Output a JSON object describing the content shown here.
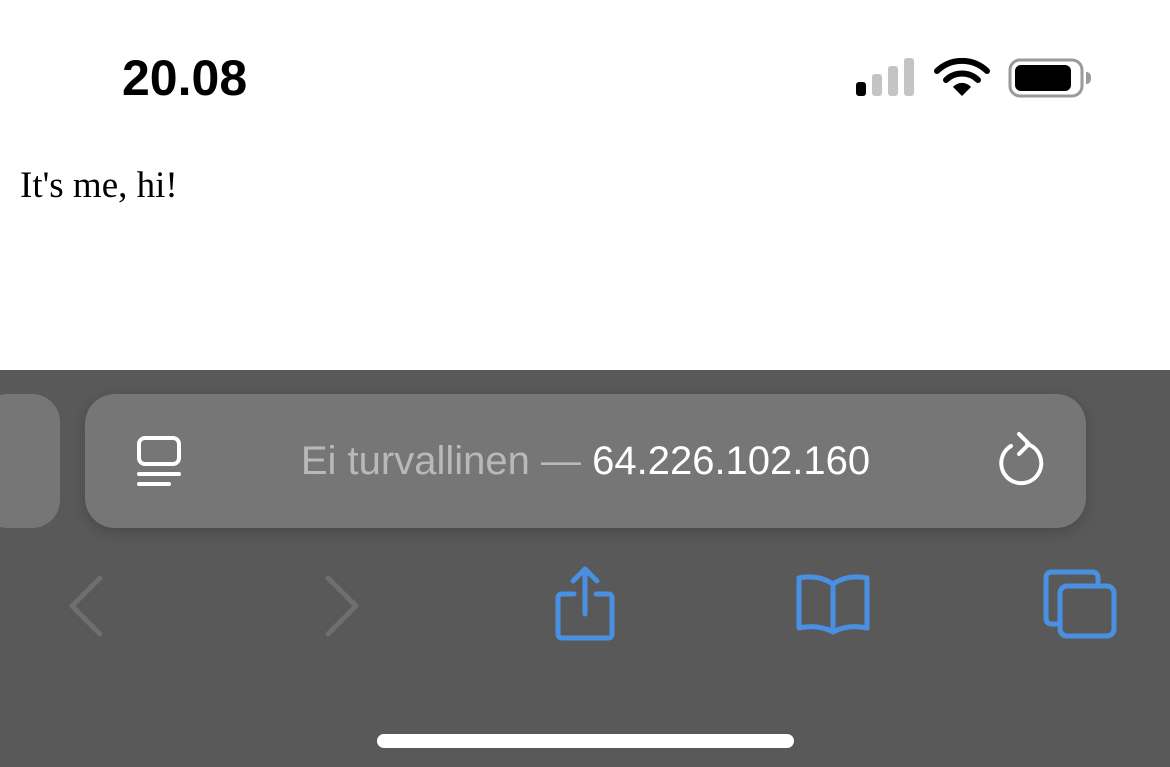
{
  "status_bar": {
    "time": "20.08",
    "signal_icon": "cellular-signal-icon",
    "wifi_icon": "wifi-icon",
    "battery_icon": "battery-icon"
  },
  "page": {
    "text": "It's me, hi!"
  },
  "browser": {
    "address_bar": {
      "security_label": "Ei turvallinen",
      "separator": " — ",
      "host": "64.226.102.160",
      "reader_icon": "reader-mode-icon",
      "reload_icon": "reload-icon"
    },
    "toolbar": {
      "back_icon": "chevron-left-icon",
      "forward_icon": "chevron-right-icon",
      "share_icon": "share-icon",
      "bookmarks_icon": "book-icon",
      "tabs_icon": "tabs-icon"
    }
  },
  "colors": {
    "toolbar_background": "#595959",
    "address_bar_background": "#767676",
    "accent_blue": "#4a90e2",
    "disabled_icon": "#6f6f6f"
  }
}
